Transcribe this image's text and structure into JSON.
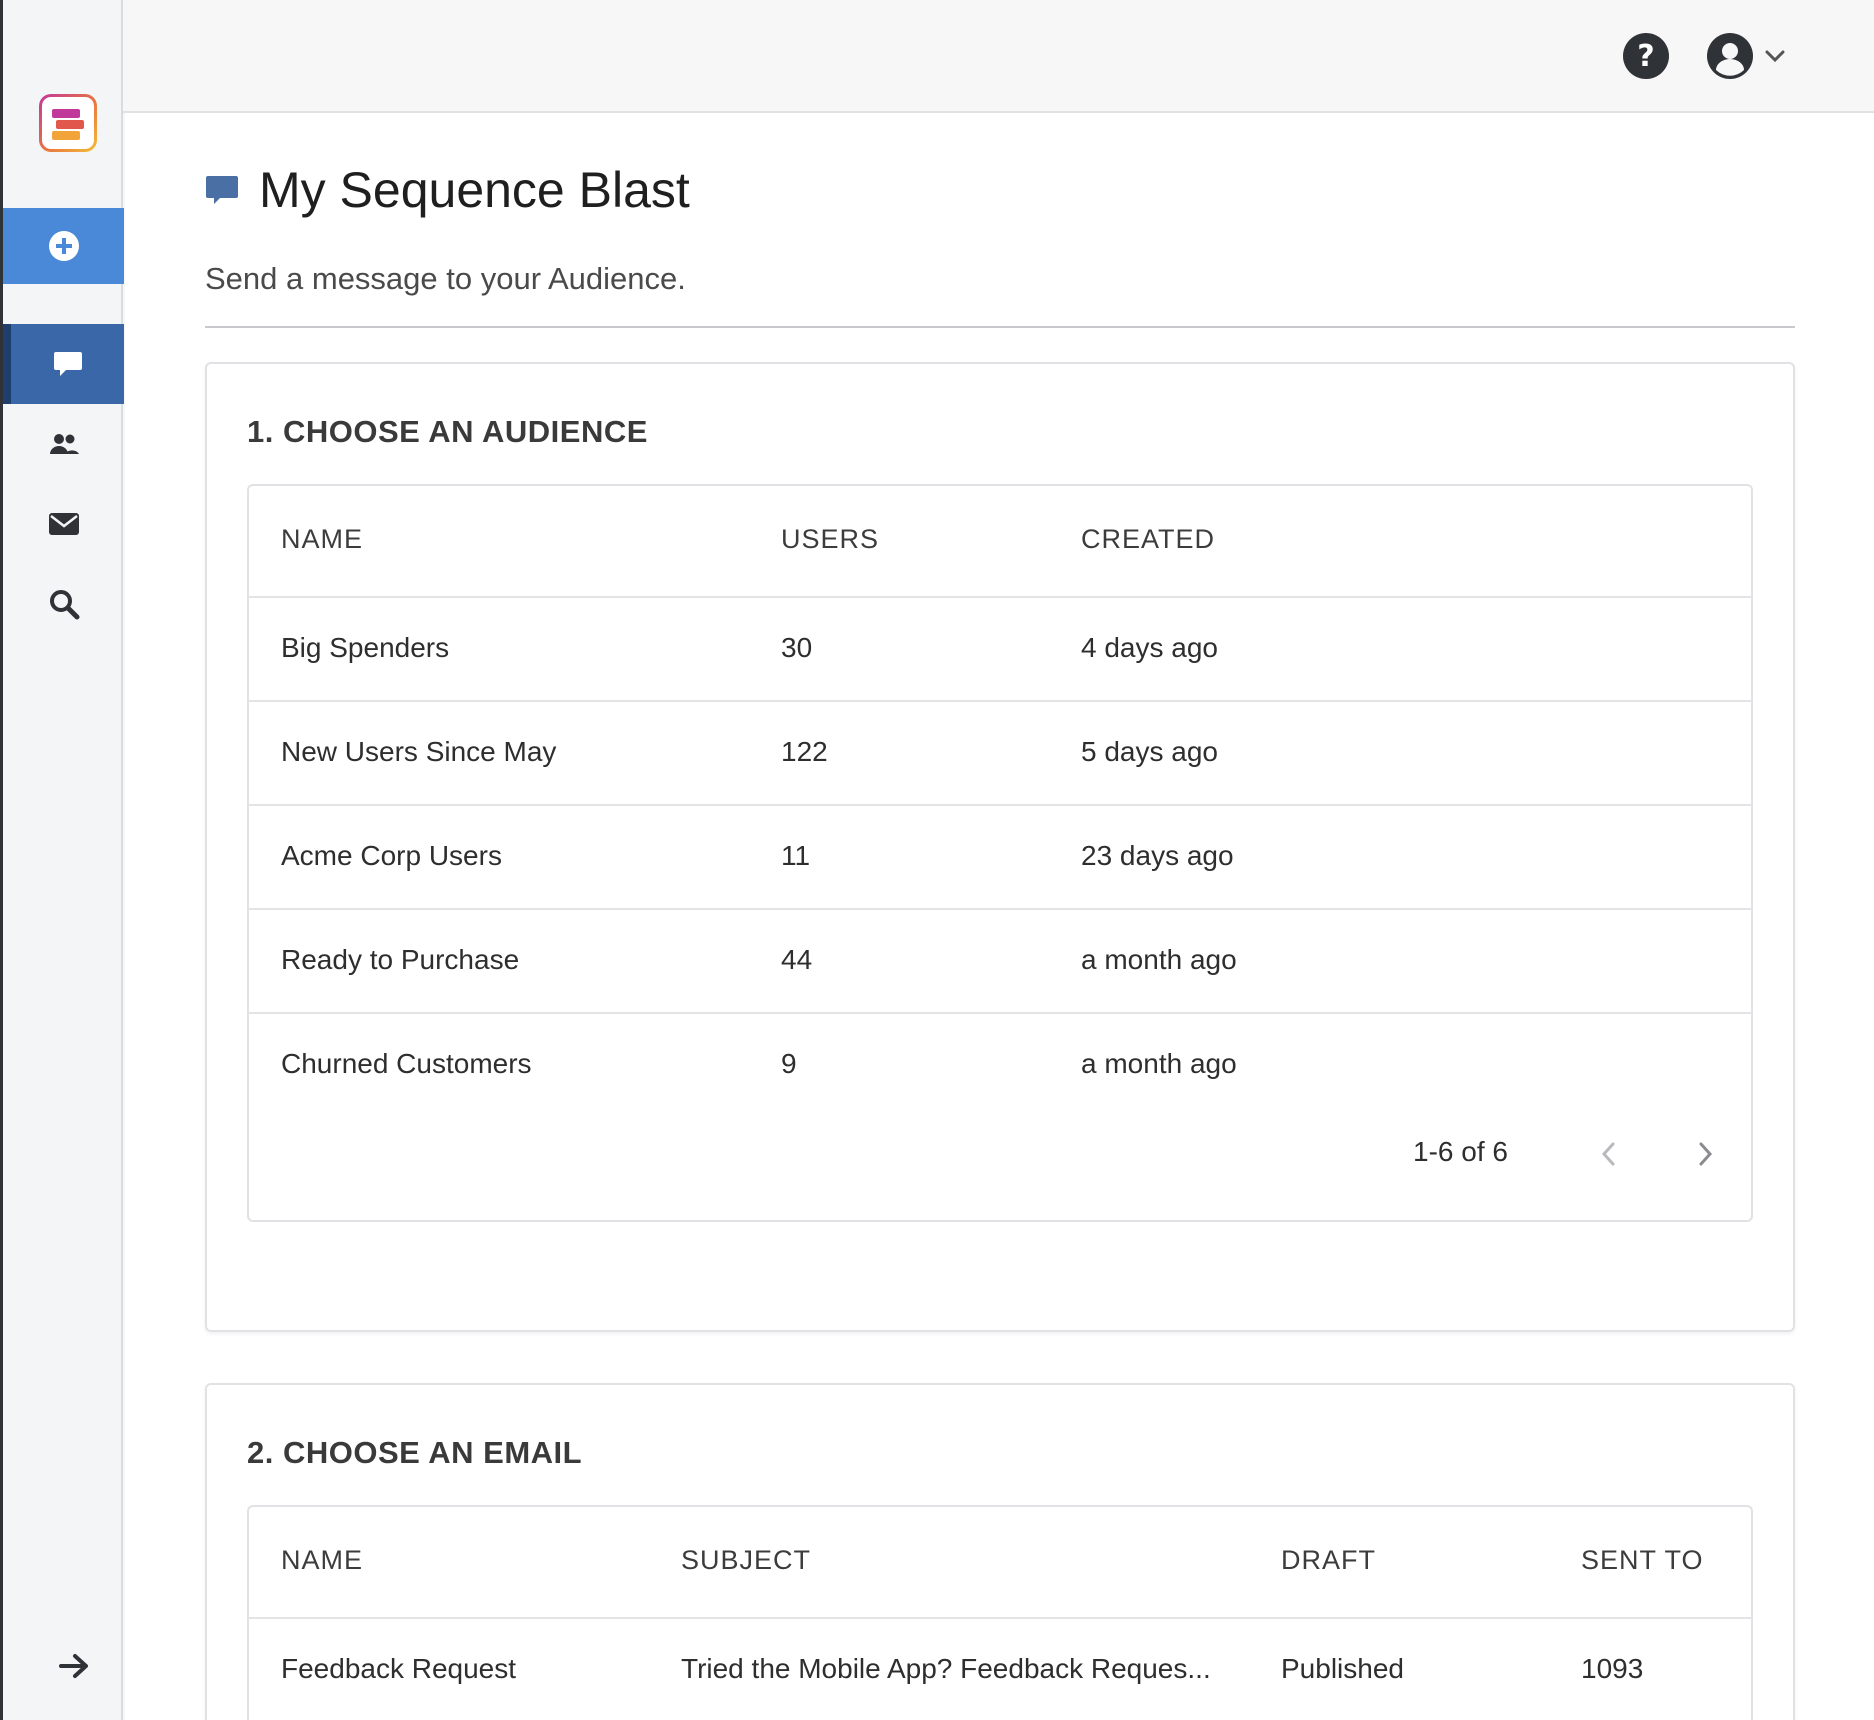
{
  "page": {
    "title": "My Sequence Blast",
    "subtitle": "Send a message to your Audience."
  },
  "sidebar": {
    "items": [
      {
        "name": "add",
        "icon": "plus-circle-icon"
      },
      {
        "name": "messages",
        "icon": "chat-bubble-icon",
        "active": true
      },
      {
        "name": "people",
        "icon": "users-icon"
      },
      {
        "name": "email",
        "icon": "envelope-icon"
      },
      {
        "name": "search",
        "icon": "search-icon"
      }
    ],
    "footer_icon": "arrow-right-icon"
  },
  "topbar": {
    "help_icon": "question-circle-icon",
    "user_icon": "user-circle-icon",
    "dropdown_icon": "chevron-down-icon"
  },
  "audience": {
    "heading": "1. CHOOSE AN AUDIENCE",
    "columns": [
      "NAME",
      "USERS",
      "CREATED"
    ],
    "rows": [
      {
        "name": "Big Spenders",
        "users": "30",
        "created": "4 days ago"
      },
      {
        "name": "New Users Since May",
        "users": "122",
        "created": "5 days ago"
      },
      {
        "name": "Acme Corp Users",
        "users": "11",
        "created": "23 days ago"
      },
      {
        "name": "Ready to Purchase",
        "users": "44",
        "created": "a month ago"
      },
      {
        "name": "Churned Customers",
        "users": "9",
        "created": "a month ago"
      }
    ],
    "pagination": "1-6 of 6"
  },
  "email": {
    "heading": "2. CHOOSE AN EMAIL",
    "columns": [
      "NAME",
      "SUBJECT",
      "DRAFT",
      "SENT TO"
    ],
    "rows": [
      {
        "name": "Feedback Request",
        "subject": "Tried the Mobile App? Feedback Reques...",
        "draft": "Published",
        "sent_to": "1093"
      }
    ]
  },
  "colors": {
    "accent": "#4a88d8",
    "active_nav": "#3a67a8",
    "title_icon": "#4a6fa5"
  }
}
